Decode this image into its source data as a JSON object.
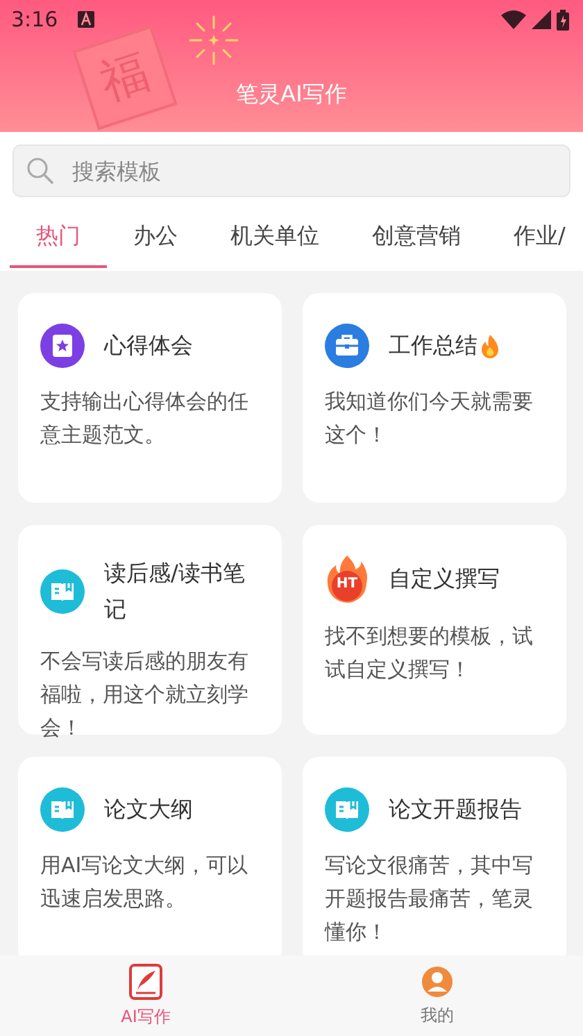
{
  "status_bar": {
    "time": "3:16"
  },
  "header": {
    "title": "笔灵AI写作",
    "decoration_text": "福"
  },
  "search": {
    "placeholder": "搜索模板"
  },
  "tabs": [
    {
      "label": "热门",
      "selected": true
    },
    {
      "label": "办公",
      "selected": false
    },
    {
      "label": "机关单位",
      "selected": false
    },
    {
      "label": "创意营销",
      "selected": false
    },
    {
      "label": "作业/",
      "selected": false
    }
  ],
  "cards": [
    {
      "kind": "star-doc",
      "title": "心得体会",
      "hot": false,
      "description": "支持输出心得体会的任意主题范文。"
    },
    {
      "kind": "toolbox",
      "title": "工作总结",
      "hot": true,
      "description": "我知道你们今天就需要这个！"
    },
    {
      "kind": "book",
      "title": "读后感/读书笔记",
      "hot": false,
      "description": "不会写读后感的朋友有福啦，用这个就立刻学会！"
    },
    {
      "kind": "flame",
      "badge": "HT",
      "title": "自定义撰写",
      "hot": false,
      "description": "找不到想要的模板，试试自定义撰写！"
    },
    {
      "kind": "book",
      "title": "论文大纲",
      "hot": false,
      "description": "用AI写论文大纲，可以迅速启发思路。"
    },
    {
      "kind": "book",
      "title": "论文开题报告",
      "hot": false,
      "description": "写论文很痛苦，其中写开题报告最痛苦，笔灵懂你！"
    }
  ],
  "bottom_nav": [
    {
      "label": "AI写作",
      "kind": "quill",
      "selected": true
    },
    {
      "label": "我的",
      "kind": "person",
      "selected": false
    }
  ]
}
